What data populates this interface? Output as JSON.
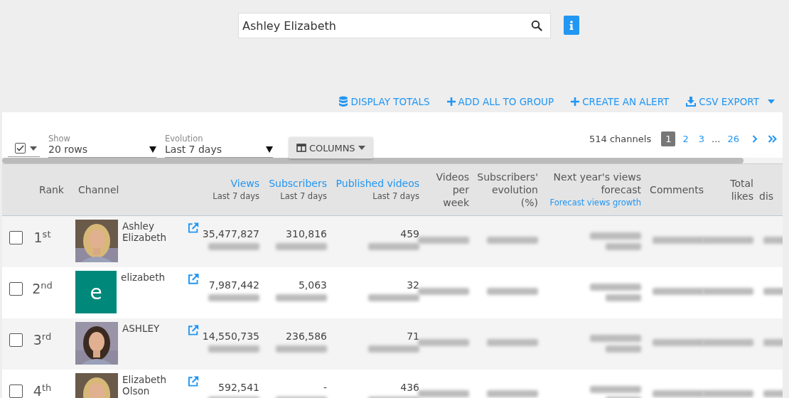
{
  "search": {
    "value": "Ashley Elizabeth"
  },
  "actions": [
    {
      "label": "DISPLAY TOTALS"
    },
    {
      "label": "ADD ALL TO GROUP"
    },
    {
      "label": "CREATE AN ALERT"
    },
    {
      "label": "CSV EXPORT"
    }
  ],
  "toolbar": {
    "select_all": {
      "checked": true
    },
    "show": {
      "label": "Show",
      "value": "20 rows"
    },
    "evolution": {
      "label": "Evolution",
      "value": "Last 7 days"
    },
    "columns_button": "COLUMNS",
    "channel_count": "514 channels",
    "pages": [
      {
        "label": "1",
        "selected": true
      },
      {
        "label": "2",
        "selected": false
      },
      {
        "label": "3",
        "selected": false
      },
      {
        "label": "26",
        "selected": false
      }
    ],
    "ellipsis": "..."
  },
  "table": {
    "columns": [
      {
        "lines": [
          "Rank"
        ],
        "link": false
      },
      {
        "lines": [
          "Channel"
        ],
        "link": false
      },
      {
        "lines": [
          "Views"
        ],
        "link": true,
        "subtitle": "Last 7 days"
      },
      {
        "lines": [
          "Subscribers"
        ],
        "link": true,
        "subtitle": "Last 7 days"
      },
      {
        "lines": [
          "Published videos"
        ],
        "link": true,
        "subtitle": "Last 7 days"
      },
      {
        "lines": [
          "Videos",
          "per",
          "week"
        ],
        "link": false
      },
      {
        "lines": [
          "Subscribers'",
          "evolution",
          "(%)"
        ],
        "link": false
      },
      {
        "lines": [
          "Next year's views",
          "forecast"
        ],
        "link": false,
        "subtitle": "Forecast views growth",
        "subtitle_link": true
      },
      {
        "lines": [
          "Comments"
        ],
        "link": false
      },
      {
        "lines": [
          "Total",
          "likes"
        ],
        "link": false
      },
      {
        "lines": [
          "dis"
        ],
        "link": false
      }
    ],
    "rows": [
      {
        "selected": false,
        "rank": "1$^{st}$",
        "channel": "Ashley Elizabeth",
        "views": "35,477,827",
        "subscribers": "310,816",
        "published_videos": "459"
      },
      {
        "selected": false,
        "rank": "2$^{nd}$",
        "channel": "elizabeth",
        "avatar": {
          "kind": "letter",
          "letter": "e",
          "color": "#00897b"
        },
        "views": "7,987,442",
        "subscribers": "5,063",
        "published_videos": "32"
      },
      {
        "selected": false,
        "rank": "3$^{rd}$",
        "channel": "ASHLEY",
        "views": "14,550,735",
        "subscribers": "236,586",
        "published_videos": "71"
      },
      {
        "selected": false,
        "rank": "4$^{th}$",
        "channel": "Elizabeth Olson",
        "views": "592,541",
        "subscribers": "-",
        "published_videos": "436"
      }
    ]
  }
}
